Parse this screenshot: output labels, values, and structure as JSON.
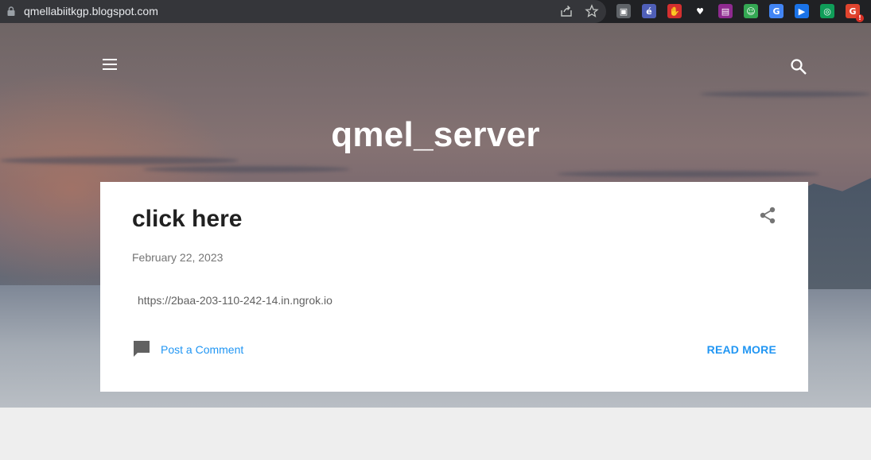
{
  "browser": {
    "url": "qmellabiitkgp.blogspot.com",
    "extensions": [
      {
        "name": "camera-extension-icon",
        "color": "#5f6368",
        "glyph": "▣"
      },
      {
        "name": "edge-style-extension-icon",
        "color": "#4f5fb8",
        "glyph": "é"
      },
      {
        "name": "stop-hand-extension-icon",
        "color": "#d32f2f",
        "glyph": "✋"
      },
      {
        "name": "heart-extension-icon",
        "color": "#202124",
        "glyph": "♥"
      },
      {
        "name": "office-extension-icon",
        "color": "#8e2a8f",
        "glyph": "▤"
      },
      {
        "name": "robot-extension-icon",
        "color": "#34a853",
        "glyph": "☺"
      },
      {
        "name": "google-extension-icon",
        "color": "#4285f4",
        "glyph": "G"
      },
      {
        "name": "screen-capture-extension-icon",
        "color": "#1a73e8",
        "glyph": "▶"
      },
      {
        "name": "magnifier-extension-icon",
        "color": "#0f9d58",
        "glyph": "◎"
      },
      {
        "name": "grammar-extension-icon",
        "color": "#e0442e",
        "glyph": "G",
        "badge": "!"
      }
    ]
  },
  "blog": {
    "title": "qmel_server"
  },
  "post": {
    "title": "click here",
    "date": "February 22, 2023",
    "body": "https://2baa-203-110-242-14.in.ngrok.io",
    "comment_label": "Post a Comment",
    "read_more_label": "READ MORE"
  },
  "colors": {
    "accent": "#2196f3",
    "title_text": "#212121",
    "page_background": "#eeeeee"
  }
}
